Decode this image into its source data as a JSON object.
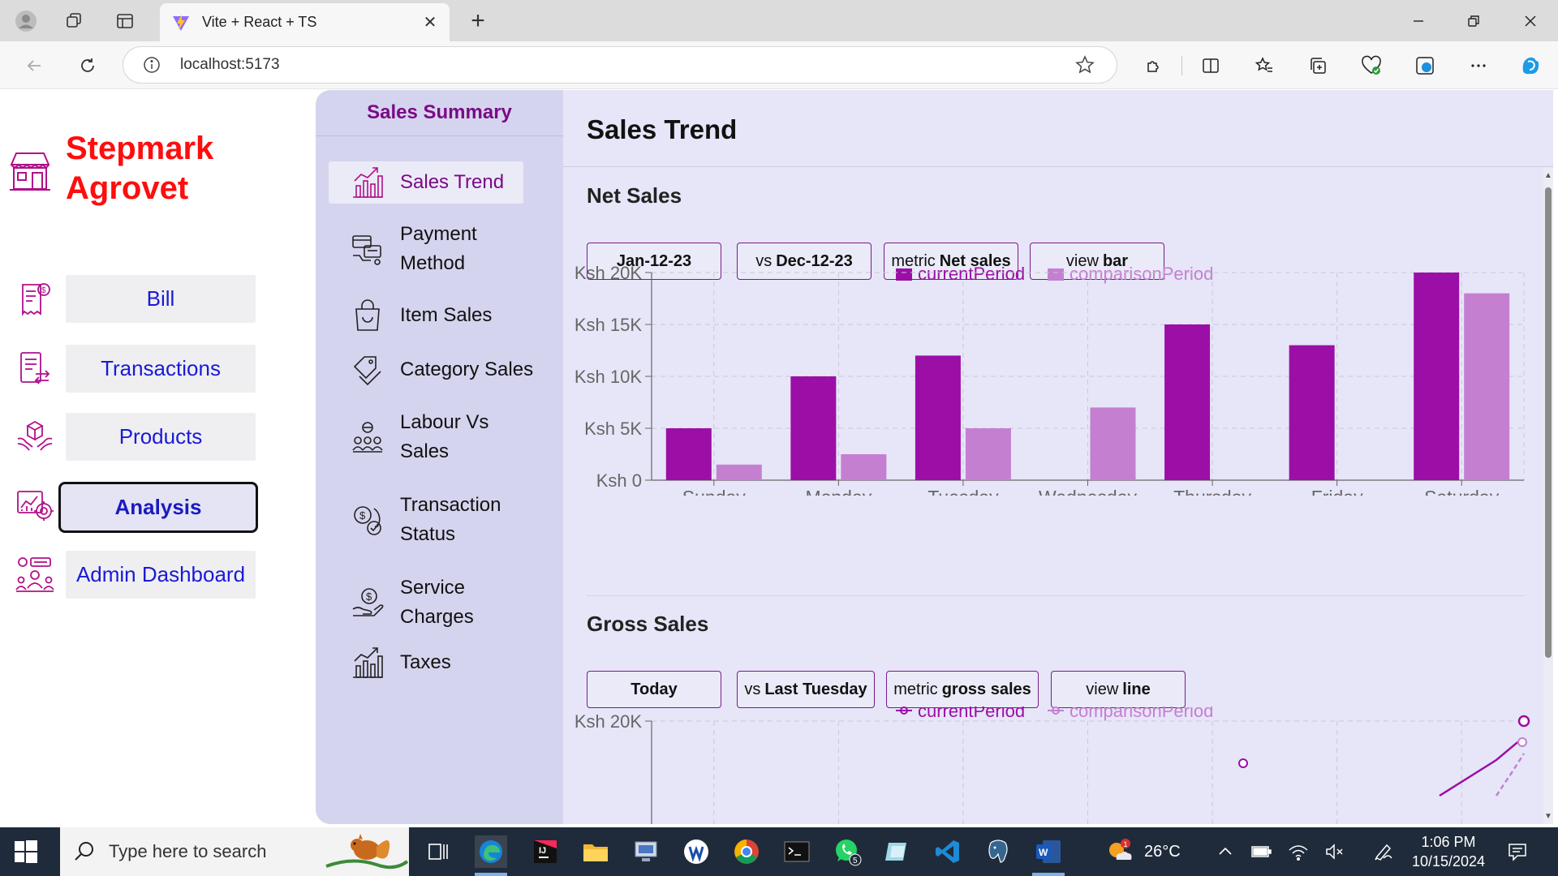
{
  "browser": {
    "tab_title": "Vite + React + TS",
    "url": "localhost:5173"
  },
  "brand": {
    "line1": "Stepmark",
    "line2": "Agrovet"
  },
  "sidebar": {
    "items": [
      {
        "label": "Bill",
        "icon": "bill-icon"
      },
      {
        "label": "Transactions",
        "icon": "transactions-icon"
      },
      {
        "label": "Products",
        "icon": "products-icon"
      },
      {
        "label": "Analysis",
        "icon": "analysis-icon",
        "active": true
      },
      {
        "label": "Admin Dashboard",
        "icon": "admin-dashboard-icon"
      }
    ]
  },
  "summary": {
    "title": "Sales Summary",
    "items": [
      {
        "label": "Sales Trend",
        "icon": "sales-trend-icon",
        "active": true
      },
      {
        "label": "Payment Method",
        "icon": "payment-method-icon"
      },
      {
        "label": "Item Sales",
        "icon": "item-sales-icon"
      },
      {
        "label": "Category Sales",
        "icon": "category-sales-icon"
      },
      {
        "label": "Labour Vs Sales",
        "icon": "labour-vs-sales-icon"
      },
      {
        "label": "Transaction Status",
        "icon": "transaction-status-icon"
      },
      {
        "label": "Service Charges",
        "icon": "service-charges-icon"
      },
      {
        "label": "Taxes",
        "icon": "taxes-icon"
      }
    ]
  },
  "main": {
    "title": "Sales Trend",
    "net_sales": {
      "title": "Net Sales",
      "controls": {
        "date": "Jan-12-23",
        "compare_prefix": "vs",
        "compare_value": "Dec-12-23",
        "metric_prefix": "metric",
        "metric_value": "Net sales",
        "view_prefix": "view",
        "view_value": "bar"
      }
    },
    "gross_sales": {
      "title": "Gross Sales",
      "controls": {
        "date": "Today",
        "compare_prefix": "vs",
        "compare_value": "Last Tuesday",
        "metric_prefix": "metric",
        "metric_value": "gross sales",
        "view_prefix": "view",
        "view_value": "line"
      }
    }
  },
  "chart_data": [
    {
      "type": "bar",
      "title": "Net Sales",
      "categories": [
        "Sunday",
        "Monday",
        "Tuesday",
        "Wednesday",
        "Thursday",
        "Friday",
        "Saturday"
      ],
      "series": [
        {
          "name": "currentPeriod",
          "values": [
            5000,
            10000,
            12000,
            0,
            15000,
            13000,
            20000
          ],
          "color": "#9b0fa6"
        },
        {
          "name": "comparisonPeriod",
          "values": [
            1500,
            2500,
            5000,
            7000,
            0,
            0,
            18000
          ],
          "color": "#c57fd1"
        }
      ],
      "yticks": [
        "Ksh 0",
        "Ksh 5K",
        "Ksh 10K",
        "Ksh 15K",
        "Ksh 20K"
      ],
      "ylim": [
        0,
        20000
      ],
      "grid": true,
      "legend": "top-center"
    },
    {
      "type": "line",
      "title": "Gross Sales",
      "visible_ytick": "Ksh 20K",
      "ylim": [
        0,
        20000
      ],
      "series": [
        {
          "name": "currentPeriod",
          "color": "#9b0fa6"
        },
        {
          "name": "comparisonPeriod",
          "color": "#c57fd1"
        }
      ],
      "grid": true,
      "legend": "top-center"
    }
  ],
  "taskbar": {
    "search_placeholder": "Type here to search",
    "weather": "26°C",
    "weather_badge": "1",
    "whatsapp_badge": "5",
    "time": "1:06 PM",
    "date": "10/15/2024"
  },
  "colors": {
    "accent": "#7a0a86",
    "brand": "#ff0d0d",
    "link": "#1a1ad6",
    "panel": "#d4d4ee",
    "content_bg": "#e6e6f8"
  }
}
